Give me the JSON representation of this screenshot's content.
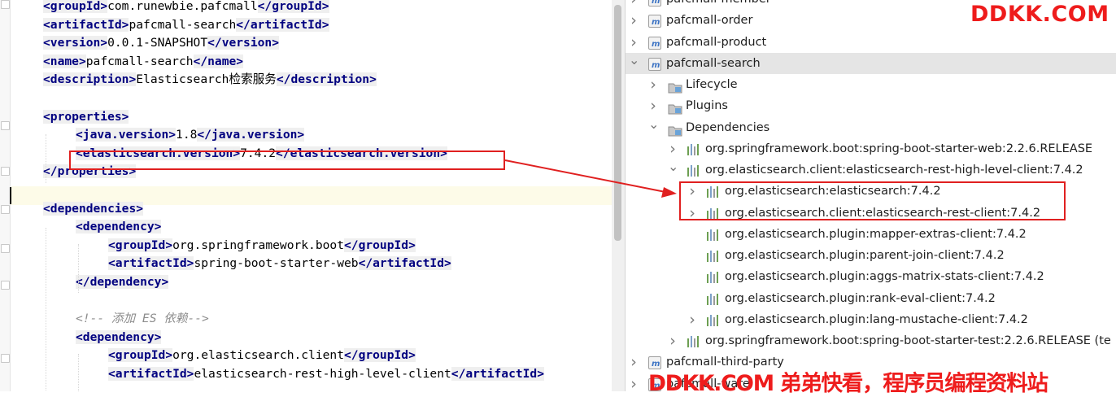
{
  "editor": {
    "lines": [
      {
        "indent": 0,
        "tag": "groupId",
        "value": "com.runewbie.pafcmall"
      },
      {
        "indent": 0,
        "tag": "artifactId",
        "value": "pafcmall-search"
      },
      {
        "indent": 0,
        "tag": "version",
        "value": "0.0.1-SNAPSHOT"
      },
      {
        "indent": 0,
        "tag": "name",
        "value": "pafcmall-search"
      },
      {
        "indent": 0,
        "tag": "description",
        "value": "Elasticsearch检索服务"
      },
      {
        "blank": true
      },
      {
        "indent": 0,
        "open": "properties"
      },
      {
        "indent": 1,
        "tag": "java.version",
        "value": "1.8"
      },
      {
        "indent": 1,
        "tag": "elasticsearch.version",
        "value": "7.4.2"
      },
      {
        "indent": 0,
        "close": "properties"
      },
      {
        "blank": true
      },
      {
        "indent": 0,
        "open": "dependencies"
      },
      {
        "indent": 1,
        "open": "dependency"
      },
      {
        "indent": 2,
        "tag": "groupId",
        "value": "org.springframework.boot"
      },
      {
        "indent": 2,
        "tag": "artifactId",
        "value": "spring-boot-starter-web"
      },
      {
        "indent": 1,
        "close": "dependency"
      },
      {
        "blank": true
      },
      {
        "indent": 1,
        "comment": "<!-- 添加 ES 依赖-->"
      },
      {
        "indent": 1,
        "open": "dependency"
      },
      {
        "indent": 2,
        "tag": "groupId",
        "value": "org.elasticsearch.client"
      },
      {
        "indent": 2,
        "tag": "artifactId",
        "value": "elasticsearch-rest-high-level-client"
      }
    ]
  },
  "maven_tree": {
    "rows": [
      {
        "level": 0,
        "expand": "collapsed",
        "icon": "module-icon",
        "label": "pafcmall-member"
      },
      {
        "level": 0,
        "expand": "collapsed",
        "icon": "module-icon",
        "label": "pafcmall-order"
      },
      {
        "level": 0,
        "expand": "collapsed",
        "icon": "module-icon",
        "label": "pafcmall-product"
      },
      {
        "level": 0,
        "expand": "expanded",
        "icon": "module-icon",
        "label": "pafcmall-search",
        "selected": true
      },
      {
        "level": 1,
        "expand": "collapsed",
        "icon": "lifecycle-folder-icon",
        "label": "Lifecycle"
      },
      {
        "level": 1,
        "expand": "collapsed",
        "icon": "plugins-folder-icon",
        "label": "Plugins"
      },
      {
        "level": 1,
        "expand": "expanded",
        "icon": "dependencies-folder-icon",
        "label": "Dependencies"
      },
      {
        "level": 2,
        "expand": "collapsed",
        "icon": "library-icon",
        "label": "org.springframework.boot:spring-boot-starter-web:2.2.6.RELEASE"
      },
      {
        "level": 2,
        "expand": "expanded",
        "icon": "library-icon",
        "label": "org.elasticsearch.client:elasticsearch-rest-high-level-client:7.4.2"
      },
      {
        "level": 3,
        "expand": "collapsed",
        "icon": "library-icon",
        "label": "org.elasticsearch:elasticsearch:7.4.2"
      },
      {
        "level": 3,
        "expand": "collapsed",
        "icon": "library-icon",
        "label": "org.elasticsearch.client:elasticsearch-rest-client:7.4.2"
      },
      {
        "level": 3,
        "expand": "none",
        "icon": "library-icon",
        "label": "org.elasticsearch.plugin:mapper-extras-client:7.4.2"
      },
      {
        "level": 3,
        "expand": "none",
        "icon": "library-icon",
        "label": "org.elasticsearch.plugin:parent-join-client:7.4.2"
      },
      {
        "level": 3,
        "expand": "none",
        "icon": "library-icon",
        "label": "org.elasticsearch.plugin:aggs-matrix-stats-client:7.4.2"
      },
      {
        "level": 3,
        "expand": "none",
        "icon": "library-icon",
        "label": "org.elasticsearch.plugin:rank-eval-client:7.4.2"
      },
      {
        "level": 3,
        "expand": "collapsed",
        "icon": "library-icon",
        "label": "org.elasticsearch.plugin:lang-mustache-client:7.4.2"
      },
      {
        "level": 2,
        "expand": "collapsed",
        "icon": "library-icon",
        "label": "org.springframework.boot:spring-boot-starter-test:2.2.6.RELEASE (te"
      },
      {
        "level": 0,
        "expand": "collapsed",
        "icon": "module-icon",
        "label": "pafcmall-third-party"
      },
      {
        "level": 0,
        "expand": "collapsed",
        "icon": "module-icon",
        "label": "pafcmall-ware"
      }
    ]
  },
  "watermark": {
    "top": "DDKK.COM",
    "bottom": "DDKK.COM 弟弟快看，程序员编程资料站"
  },
  "colors": {
    "tag": "#000080",
    "tag_bg": "#efefef",
    "comment": "#8c8c8c",
    "highlight_box": "#e02020",
    "watermark": "#ee1c1c",
    "selected_row": "#e5e5e5"
  }
}
